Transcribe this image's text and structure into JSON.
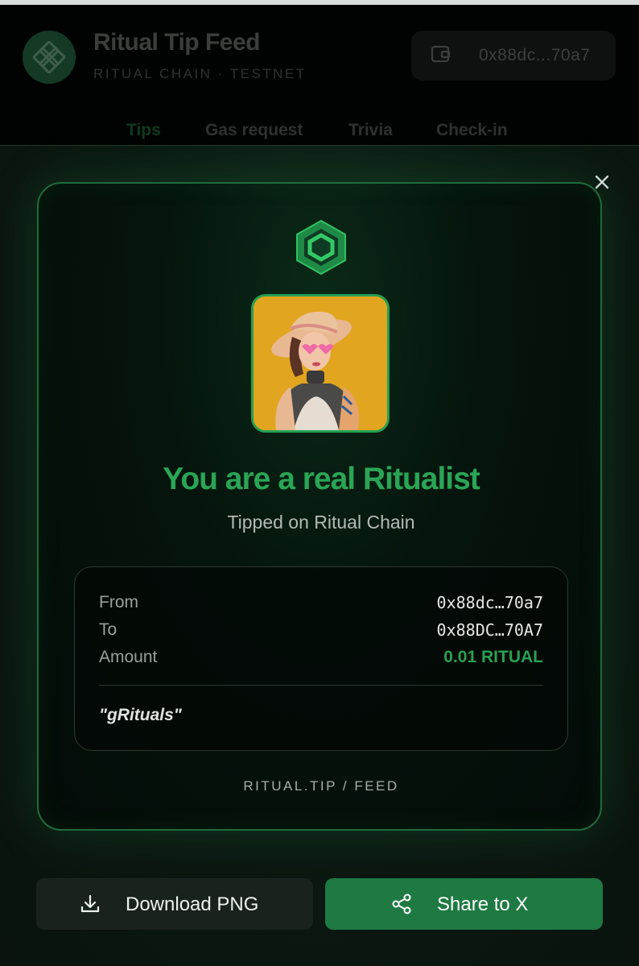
{
  "app": {
    "title": "Ritual Tip Feed",
    "subtitle": "RITUAL CHAIN · TESTNET",
    "wallet_address": "0x88dc...70a7"
  },
  "nav": {
    "tabs": [
      {
        "label": "Tips",
        "active": true
      },
      {
        "label": "Gas request",
        "active": false
      },
      {
        "label": "Trivia",
        "active": false
      },
      {
        "label": "Check-in",
        "active": false
      }
    ]
  },
  "modal": {
    "headline": "You are a real Ritualist",
    "subhead": "Tipped on Ritual Chain",
    "details": {
      "from_label": "From",
      "from_value": "0x88dc…70a7",
      "to_label": "To",
      "to_value": "0x88DC…70A7",
      "amount_label": "Amount",
      "amount_value": "0.01 RITUAL",
      "memo": "\"gRituals\""
    },
    "footer_mark": "RITUAL.TIP / FEED",
    "download_label": "Download PNG",
    "share_label": "Share to X"
  },
  "icons": {
    "logo": "knot-logo-icon",
    "wallet": "wallet-icon",
    "close": "close-icon",
    "hex": "hexagon-logo-icon",
    "download": "download-icon",
    "share": "share-icon"
  },
  "colors": {
    "accent_green": "#2aa556",
    "share_button": "#1e7a42",
    "background": "#0a130e"
  }
}
